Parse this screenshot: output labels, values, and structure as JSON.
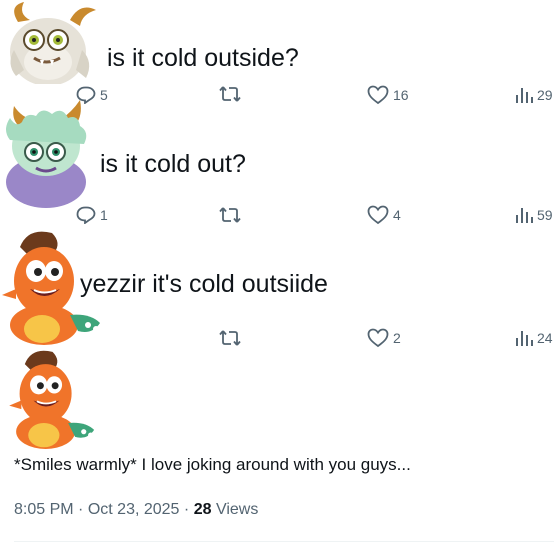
{
  "posts": [
    {
      "text": "is it cold outside?",
      "replies": "5",
      "likes": "16",
      "views": "29",
      "avatar": "white-horned-monster-icon"
    },
    {
      "text": "is it cold out?",
      "replies": "1",
      "likes": "4",
      "views": "59",
      "avatar": "purple-fluffy-horned-monster-icon"
    },
    {
      "text": "yezzir it's cold outsiide",
      "likes": "2",
      "views": "24",
      "avatar": "orange-dragon-monster-icon"
    }
  ],
  "final_post": {
    "text": "*Smiles warmly* I love joking around with you guys...",
    "time": "8:05 PM",
    "date": "Oct 23, 2025",
    "separator": "·",
    "views_count": "28",
    "views_label": "Views",
    "avatar": "orange-dragon-monster-icon"
  },
  "colors": {
    "text": "#0f1419",
    "muted": "#536471",
    "orange_monster": "#f0742a",
    "purple_monster": "#9a87c8",
    "gray_monster": "#e4e0d6"
  }
}
